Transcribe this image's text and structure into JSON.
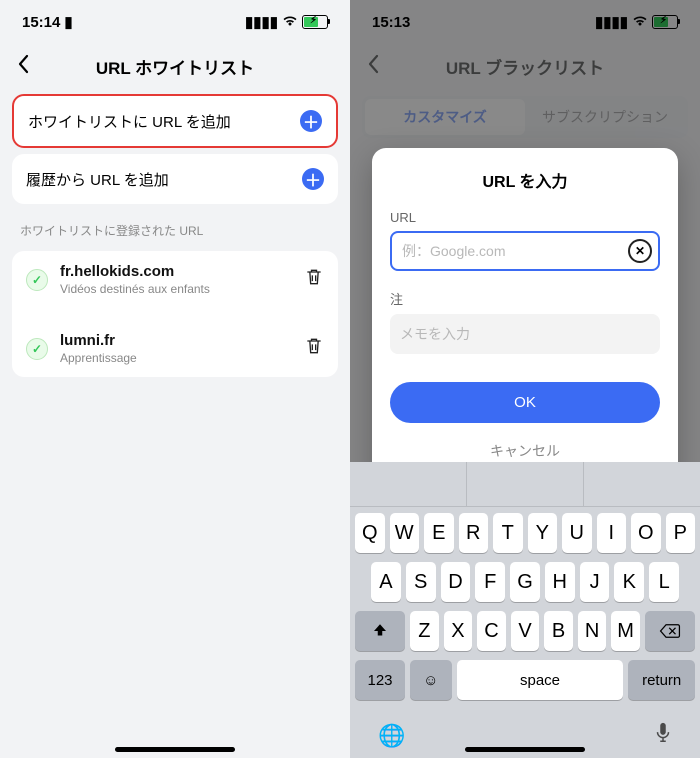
{
  "left": {
    "status": {
      "time": "15:14"
    },
    "title": "URL ホワイトリスト",
    "add_whitelist": "ホワイトリストに URL を追加",
    "add_history": "履歴から URL を追加",
    "section": "ホワイトリストに登録された URL",
    "items": [
      {
        "title": "fr.hellokids.com",
        "sub": "Vidéos destinés aux enfants"
      },
      {
        "title": "lumni.fr",
        "sub": "Apprentissage"
      }
    ]
  },
  "right": {
    "status": {
      "time": "15:13"
    },
    "title": "URL ブラックリスト",
    "seg": {
      "a": "カスタマイズ",
      "b": "サブスクリプション"
    },
    "modal": {
      "title": "URL を入力",
      "url_label": "URL",
      "url_placeholder": "例：Google.com",
      "note_label": "注",
      "memo_placeholder": "メモを入力",
      "ok": "OK",
      "cancel": "キャンセル"
    },
    "keyboard": {
      "row1": [
        "Q",
        "W",
        "E",
        "R",
        "T",
        "Y",
        "U",
        "I",
        "O",
        "P"
      ],
      "row2": [
        "A",
        "S",
        "D",
        "F",
        "G",
        "H",
        "J",
        "K",
        "L"
      ],
      "row3": [
        "Z",
        "X",
        "C",
        "V",
        "B",
        "N",
        "M"
      ],
      "num": "123",
      "space": "space",
      "ret": "return"
    }
  }
}
